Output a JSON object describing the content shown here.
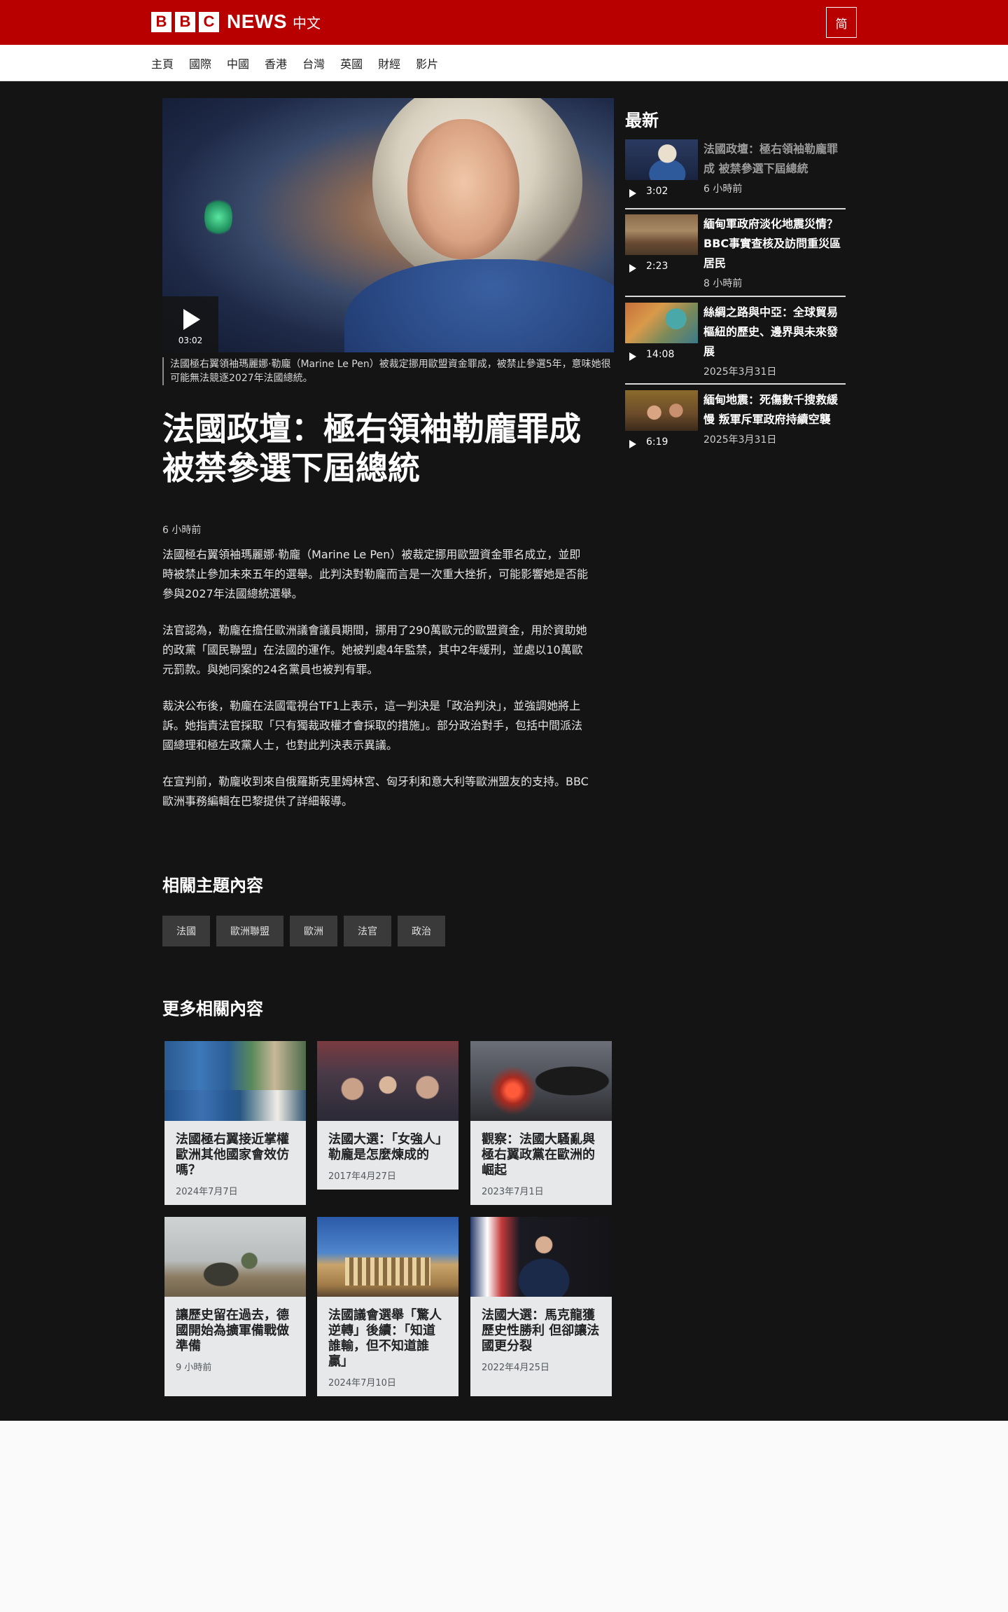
{
  "header": {
    "brand_letters": [
      "B",
      "B",
      "C"
    ],
    "brand_news": "NEWS",
    "brand_lang": "中文",
    "script_toggle": "简"
  },
  "nav": {
    "items": [
      {
        "label": "主頁"
      },
      {
        "label": "國際"
      },
      {
        "label": "中國"
      },
      {
        "label": "香港"
      },
      {
        "label": "台灣"
      },
      {
        "label": "英國"
      },
      {
        "label": "財經"
      },
      {
        "label": "影片"
      }
    ]
  },
  "article": {
    "video_duration": "03:02",
    "caption": "法國極右翼領袖瑪麗娜·勒龐（Marine Le Pen）被裁定挪用歐盟資金罪成，被禁止參選5年，意味她很可能無法競逐2027年法國總統。",
    "headline": "法國政壇：極右領袖勒龐罪成 被禁參選下屆總統",
    "published": "6 小時前",
    "paragraphs": [
      "法國極右翼領袖瑪麗娜·勒龐（Marine Le Pen）被裁定挪用歐盟資金罪名成立，並即時被禁止參加未來五年的選舉。此判決對勒龐而言是一次重大挫折，可能影響她是否能參與2027年法國總統選舉。",
      "法官認為，勒龐在擔任歐洲議會議員期間，挪用了290萬歐元的歐盟資金，用於資助她的政黨「國民聯盟」在法國的運作。她被判處4年監禁，其中2年緩刑，並處以10萬歐元罰款。與她同案的24名黨員也被判有罪。",
      "裁決公布後，勒龐在法國電視台TF1上表示，這一判決是「政治判決」，並強調她將上訴。她指責法官採取「只有獨裁政權才會採取的措施」。部分政治對手，包括中間派法國總理和極左政黨人士，也對此判決表示異議。",
      "在宣判前，勒龐收到來自俄羅斯克里姆林宮、匈牙利和意大利等歐洲盟友的支持。BBC歐洲事務編輯在巴黎提供了詳細報導。"
    ]
  },
  "topics": {
    "title": "相關主題內容",
    "tags": [
      "法國",
      "歐洲聯盟",
      "歐洲",
      "法官",
      "政治"
    ]
  },
  "related": {
    "title": "更多相關內容",
    "cards": [
      {
        "title": "法國極右翼接近掌權 歐洲其他國家會效仿嗎？",
        "date": "2024年7月7日"
      },
      {
        "title": "法國大選：「女強人」勒龐是怎麼煉成的",
        "date": "2017年4月27日"
      },
      {
        "title": "觀察：法國大騷亂與極右翼政黨在歐洲的崛起",
        "date": "2023年7月1日"
      },
      {
        "title": "讓歷史留在過去，德國開始為擴軍備戰做準備",
        "date": "9 小時前"
      },
      {
        "title": "法國議會選舉「驚人逆轉」後續：「知道誰輸，但不知道誰贏」",
        "date": "2024年7月10日"
      },
      {
        "title": "法國大選：馬克龍獲歷史性勝利 但卻讓法國更分裂",
        "date": "2022年4月25日"
      }
    ]
  },
  "latest": {
    "title": "最新",
    "items": [
      {
        "title": "法國政壇：極右領袖勒龐罪成 被禁參選下屆總統",
        "duration": "3:02",
        "time": "6 小時前",
        "visited": true
      },
      {
        "title": "緬甸軍政府淡化地震災情？BBC事實查核及訪問重災區居民",
        "duration": "2:23",
        "time": "8 小時前",
        "visited": false
      },
      {
        "title": "絲綢之路與中亞：全球貿易樞紐的歷史、邊界與未來發展",
        "duration": "14:08",
        "time": "2025年3月31日",
        "visited": false
      },
      {
        "title": "緬甸地震：死傷數千搜救緩慢 叛軍斥軍政府持續空襲",
        "duration": "6:19",
        "time": "2025年3月31日",
        "visited": false
      }
    ]
  },
  "colors": {
    "brand_red": "#b80000",
    "dark_bg": "#141414",
    "card_bg": "#e6e8ea",
    "tag_bg": "#3a3a3a"
  }
}
